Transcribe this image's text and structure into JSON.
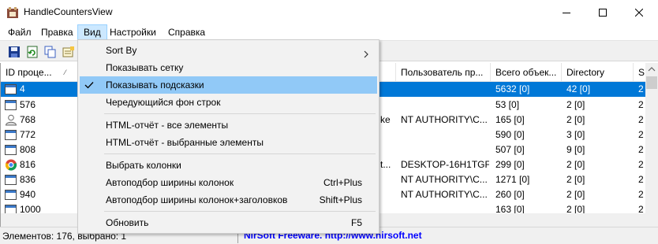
{
  "window": {
    "title": "HandleCountersView"
  },
  "menubar": {
    "items": [
      "Файл",
      "Правка",
      "Вид",
      "Настройки",
      "Справка"
    ],
    "active_index": 2
  },
  "toolbar": {
    "buttons": [
      "save-icon",
      "refresh-icon",
      "copy-icon",
      "properties-icon"
    ]
  },
  "table": {
    "columns": [
      "ID проце...",
      "Пользователь пр...",
      "Всего объек...",
      "Directory",
      "S"
    ],
    "rows": [
      {
        "id": "4",
        "icon": "window-icon",
        "extra": "",
        "user": "",
        "total": "5632  [0]",
        "dir": "42  [0]",
        "s": "2",
        "selected": true
      },
      {
        "id": "576",
        "icon": "window-icon",
        "extra": "",
        "user": "",
        "total": "53  [0]",
        "dir": "2  [0]",
        "s": "2",
        "selected": false
      },
      {
        "id": "768",
        "icon": "user-icon",
        "extra": "ke",
        "user": "NT AUTHORITY\\C...",
        "total": "165  [0]",
        "dir": "2  [0]",
        "s": "2",
        "selected": false
      },
      {
        "id": "772",
        "icon": "window-icon",
        "extra": "",
        "user": "",
        "total": "590  [0]",
        "dir": "3  [0]",
        "s": "2",
        "selected": false
      },
      {
        "id": "808",
        "icon": "window-icon",
        "extra": "",
        "user": "",
        "total": "507  [0]",
        "dir": "9  [0]",
        "s": "2",
        "selected": false
      },
      {
        "id": "816",
        "icon": "chrome-icon",
        "extra": "t...",
        "user": "DESKTOP-16H1TGF...",
        "total": "299  [0]",
        "dir": "2  [0]",
        "s": "2",
        "selected": false
      },
      {
        "id": "836",
        "icon": "window-icon",
        "extra": "",
        "user": "NT AUTHORITY\\C...",
        "total": "1271  [0]",
        "dir": "2  [0]",
        "s": "2",
        "selected": false
      },
      {
        "id": "940",
        "icon": "window-icon",
        "extra": "",
        "user": "NT AUTHORITY\\C...",
        "total": "260  [0]",
        "dir": "2  [0]",
        "s": "2",
        "selected": false
      },
      {
        "id": "1000",
        "icon": "window-icon",
        "extra": "",
        "user": "",
        "total": "163  [0]",
        "dir": "2  [0]",
        "s": "2",
        "selected": false
      }
    ]
  },
  "status": {
    "left": "Элементов: 176, выбрано: 1",
    "link": "NirSoft Freeware.  http://www.nirsoft.net"
  },
  "dropdown": {
    "items": [
      {
        "label": "Sort By",
        "shortcut": "",
        "checked": false,
        "submenu": true,
        "highlighted": false
      },
      {
        "label": "Показывать сетку",
        "shortcut": "",
        "checked": false,
        "submenu": false,
        "highlighted": false
      },
      {
        "label": "Показывать подсказки",
        "shortcut": "",
        "checked": true,
        "submenu": false,
        "highlighted": false
      },
      {
        "label": "Чередующийся фон строк",
        "shortcut": "",
        "checked": false,
        "submenu": false,
        "highlighted": false
      },
      {
        "label": "HTML-отчёт - все элементы",
        "shortcut": "",
        "checked": false,
        "submenu": false,
        "highlighted": false
      },
      {
        "label": "HTML-отчёт - выбранные элементы",
        "shortcut": "",
        "checked": false,
        "submenu": false,
        "highlighted": false
      },
      {
        "label": "Выбрать колонки",
        "shortcut": "",
        "checked": false,
        "submenu": false,
        "highlighted": false
      },
      {
        "label": "Автоподбор ширины колонок",
        "shortcut": "Ctrl+Plus",
        "checked": false,
        "submenu": false,
        "highlighted": false
      },
      {
        "label": "Автоподбор ширины колонок+заголовков",
        "shortcut": "Shift+Plus",
        "checked": false,
        "submenu": false,
        "highlighted": false
      },
      {
        "label": "Обновить",
        "shortcut": "F5",
        "checked": false,
        "submenu": false,
        "highlighted": false
      }
    ]
  },
  "colors": {
    "selection": "#0078d7",
    "menu_highlight": "#91c9f7",
    "link": "#0000ff"
  }
}
